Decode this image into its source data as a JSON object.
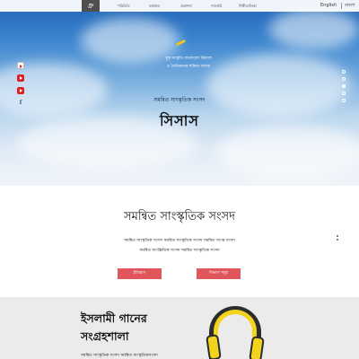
{
  "nav": {
    "logo": "ধ্রু",
    "items": [
      "পরিচিতি",
      "কার্যক্রম",
      "প্রকাশনা",
      "গ্যালারি",
      "শিল্পীতালিকা"
    ],
    "lang_en": "English",
    "lang_bn": "বাংলা"
  },
  "social": {
    "icons": [
      "youtube-icon",
      "youtube-icon",
      "facebook-icon"
    ],
    "facebook_glyph": "f"
  },
  "hero": {
    "tagline_1": "সুস্থ সংস্কৃতি বাংলাদেশ বিকাশে",
    "tagline_2": "ও নৈতিকতার শক্তিত সমাজ",
    "subtitle": "সমন্বিত সাংস্কৃতিক সংসদ",
    "logo_text": "সিসাস",
    "slide_count": 5,
    "active_slide": 1
  },
  "about": {
    "title": "সমন্বিত সাংস্কৃতিক সংসদ",
    "line_1": "সমন্বিত সাংস্কৃতিক সংসদ সমন্বিত সাংস্কৃতিক সংসদ সমন্বিত সাংস্ক সংসদ",
    "line_2": "সমন্বিত সাংস্ক্রিতিক সংসদ সমন্বিত সাংস্কৃতিক সংসদ",
    "btn_history": "ইতিহাস",
    "btn_structure": "বিভাগ সমূহ"
  },
  "library": {
    "title_1": "ইসলামী গানের",
    "title_2": "সংগ্রহশালা",
    "desc": "সমন্বিত সাংস্কৃতিক সংসদ সমন্বিত সাংস্কৃতিকসংসদ"
  },
  "colors": {
    "accent": "#e0555a",
    "headphone_yellow": "#f2d31e",
    "section_gray": "#ebebeb"
  }
}
